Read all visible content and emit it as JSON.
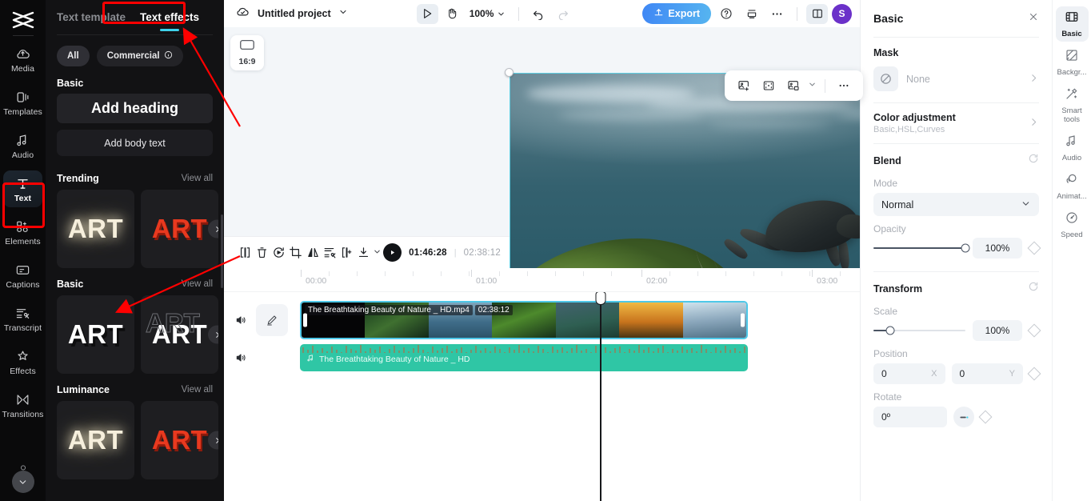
{
  "left_rail": {
    "logo_icon": "capcut-logo",
    "items": [
      {
        "label": "Media",
        "icon": "media-cloud-icon",
        "active": false
      },
      {
        "label": "Templates",
        "icon": "templates-icon",
        "active": false
      },
      {
        "label": "Audio",
        "icon": "audio-note-icon",
        "active": false
      },
      {
        "label": "Text",
        "icon": "text-t-icon",
        "active": true
      },
      {
        "label": "Elements",
        "icon": "elements-icon",
        "active": false
      },
      {
        "label": "Captions",
        "icon": "captions-icon",
        "active": false
      },
      {
        "label": "Transcript",
        "icon": "transcript-icon",
        "active": false
      },
      {
        "label": "Effects",
        "icon": "effects-star-icon",
        "active": false
      },
      {
        "label": "Transitions",
        "icon": "transitions-icon",
        "active": false
      }
    ],
    "collapse_icon": "chevron-down-icon"
  },
  "text_panel": {
    "tabs": [
      {
        "label": "Text template",
        "active": false
      },
      {
        "label": "Text effects",
        "active": true
      }
    ],
    "filters": [
      {
        "label": "All",
        "selected": true
      },
      {
        "label": "Commercial",
        "info_icon": "info-icon",
        "selected": false
      }
    ],
    "basic_section_title": "Basic",
    "add_heading_label": "Add heading",
    "add_body_text_label": "Add body text",
    "view_all_label": "View all",
    "sections": [
      {
        "title": "Trending",
        "cards": [
          {
            "text": "ART",
            "style": "glow"
          },
          {
            "text": "ART",
            "style": "red"
          }
        ]
      },
      {
        "title": "Basic",
        "cards": [
          {
            "text": "ART",
            "style": "white"
          },
          {
            "text": "ART",
            "style": "outline"
          }
        ]
      },
      {
        "title": "Luminance",
        "cards": [
          {
            "text": "ART",
            "style": "glow"
          },
          {
            "text": "ART",
            "style": "red"
          }
        ]
      }
    ]
  },
  "header": {
    "cloud_icon": "cloud-saved-icon",
    "project_name": "Untitled project",
    "project_dropdown_icon": "chevron-down-icon",
    "select_tool_icon": "cursor-arrow-icon",
    "hand_tool_icon": "hand-icon",
    "zoom_level": "100%",
    "zoom_dropdown_icon": "chevron-down-icon",
    "undo_icon": "undo-icon",
    "redo_icon": "redo-icon",
    "export_label": "Export",
    "export_icon": "upload-icon",
    "help_icon": "help-circle-icon",
    "print_icon": "layers-icon",
    "more_icon": "more-horizontal-icon",
    "layout_icon": "split-layout-icon",
    "avatar_initial": "S",
    "avatar_color": "#6b31c9",
    "export_color": "#4a95f2"
  },
  "stage": {
    "ratio_icon": "aspect-ratio-icon",
    "ratio_label": "16:9",
    "float_toolbar": [
      {
        "icon": "add-image-icon"
      },
      {
        "icon": "fit-frame-icon"
      },
      {
        "icon": "replace-media-icon",
        "has_dropdown": true
      },
      {
        "icon": "more-horizontal-icon"
      }
    ],
    "selection_color": "#4ec8e8",
    "rotate_icon": "rotate-handle-icon"
  },
  "timeline_toolbar": {
    "tools": [
      {
        "icon": "split-icon"
      },
      {
        "icon": "delete-trash-icon"
      },
      {
        "icon": "reverse-icon"
      },
      {
        "icon": "crop-icon"
      },
      {
        "icon": "mirror-flip-icon"
      },
      {
        "icon": "remove-segment-icon"
      },
      {
        "icon": "freeze-frame-icon"
      },
      {
        "icon": "download-icon",
        "has_dropdown": true
      }
    ],
    "play_icon": "play-icon",
    "current_time": "01:46:28",
    "time_separator": "|",
    "total_time": "02:38:12",
    "mic_icon": "microphone-icon",
    "auto_cut_icon": "auto-cut-icon",
    "split-audio_icon": "split-audio-icon",
    "zoom_out_icon": "minus-circle-icon",
    "zoom_in_icon": "plus-circle-icon",
    "fullscreen_icon": "fullscreen-icon",
    "preview_icon": "preview-monitor-icon",
    "active_tool_color": "#d7f0fb"
  },
  "ruler": {
    "labels": [
      "00:00",
      "01:00",
      "02:00",
      "03:00"
    ]
  },
  "tracks": [
    {
      "type": "video",
      "speaker_icon": "speaker-icon",
      "edit_icon": "pencil-icon",
      "clip_name": "The Breathtaking Beauty of Nature _ HD.mp4",
      "clip_duration": "02:38:12",
      "selected": true
    },
    {
      "type": "audio",
      "speaker_icon": "speaker-icon",
      "clip_name": "The Breathtaking Beauty of Nature _ HD",
      "clip_icon": "audio-wave-icon",
      "color": "#2fc6a5"
    }
  ],
  "properties": {
    "title": "Basic",
    "close_icon": "close-icon",
    "mask": {
      "label": "Mask",
      "value": "None",
      "icon": "no-mask-icon",
      "chevron": "chevron-right-icon"
    },
    "color_adjustment": {
      "label": "Color adjustment",
      "sub": "Basic,HSL,Curves",
      "chevron": "chevron-right-icon"
    },
    "blend": {
      "label": "Blend",
      "reset_icon": "reset-icon",
      "mode_label": "Mode",
      "mode_value": "Normal",
      "mode_chevron": "chevron-down-icon",
      "opacity_label": "Opacity",
      "opacity_value": "100%",
      "opacity_percent": 100,
      "keyframe_icon": "keyframe-diamond-icon"
    },
    "transform": {
      "label": "Transform",
      "reset_icon": "reset-icon",
      "scale_label": "Scale",
      "scale_value": "100%",
      "scale_percent": 18,
      "position_label": "Position",
      "position_x": "0",
      "position_x_axis": "X",
      "position_y": "0",
      "position_y_axis": "Y",
      "rotate_label": "Rotate",
      "rotate_value": "0º",
      "rotate_dial_icon": "rotate-dial-icon",
      "keyframe_icon": "keyframe-diamond-icon"
    }
  },
  "right_rail": {
    "items": [
      {
        "label": "Basic",
        "icon": "film-basic-icon",
        "active": true
      },
      {
        "label": "Backgr...",
        "icon": "background-icon",
        "active": false
      },
      {
        "label": "Smart tools",
        "icon": "magic-wand-icon",
        "active": false
      },
      {
        "label": "Audio",
        "icon": "audio-note-icon",
        "active": false
      },
      {
        "label": "Animat...",
        "icon": "animation-icon",
        "active": false
      },
      {
        "label": "Speed",
        "icon": "speed-icon",
        "active": false
      }
    ]
  },
  "annotations": {
    "box_color": "#ff0000",
    "arrow_color": "#ff0000",
    "boxes": [
      "text-template-tab",
      "text-sidebar-item"
    ],
    "arrows": [
      "arrow-to-text-effects-underline",
      "arrow-to-basic-section"
    ]
  }
}
